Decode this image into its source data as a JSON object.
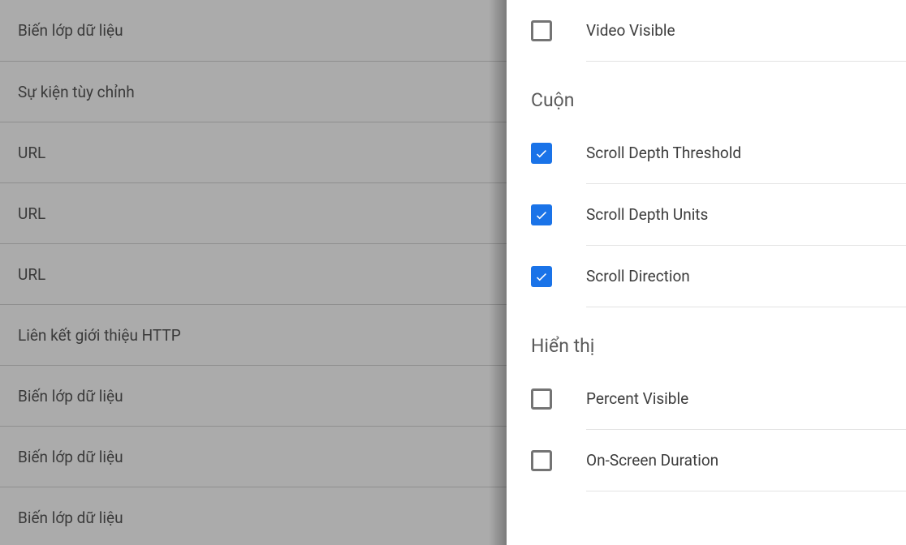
{
  "left": {
    "rows": [
      "Biến lớp dữ liệu",
      "Sự kiện tùy chỉnh",
      "URL",
      "URL",
      "URL",
      "Liên kết giới thiệu HTTP",
      "Biến lớp dữ liệu",
      "Biến lớp dữ liệu",
      "Biến lớp dữ liệu"
    ]
  },
  "right": {
    "top_item": {
      "label": "Video Visible",
      "checked": false
    },
    "sections": [
      {
        "heading": "Cuộn",
        "items": [
          {
            "label": "Scroll Depth Threshold",
            "checked": true
          },
          {
            "label": "Scroll Depth Units",
            "checked": true
          },
          {
            "label": "Scroll Direction",
            "checked": true
          }
        ]
      },
      {
        "heading": "Hiển thị",
        "items": [
          {
            "label": "Percent Visible",
            "checked": false
          },
          {
            "label": "On-Screen Duration",
            "checked": false
          }
        ]
      }
    ]
  }
}
